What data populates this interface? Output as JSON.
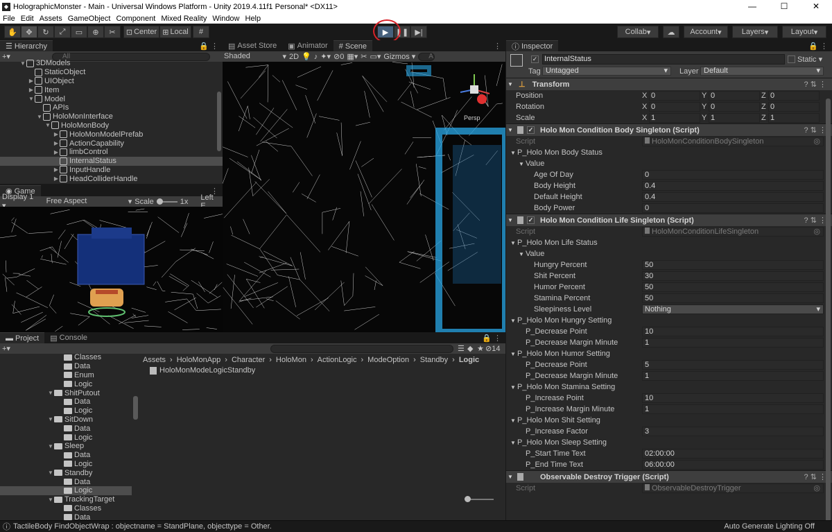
{
  "window": {
    "title": "HolographicMonster - Main - Universal Windows Platform - Unity 2019.4.11f1 Personal* <DX11>",
    "controls": {
      "minimize": "—",
      "maximize": "☐",
      "close": "✕"
    }
  },
  "menu": [
    "File",
    "Edit",
    "Assets",
    "GameObject",
    "Component",
    "Mixed Reality",
    "Window",
    "Help"
  ],
  "toolbar": {
    "pivot": "Center",
    "space": "Local",
    "collab": "Collab",
    "account": "Account",
    "layers": "Layers",
    "layout": "Layout"
  },
  "hierarchy": {
    "tab": "Hierarchy",
    "search_placeholder": "All",
    "items": [
      {
        "label": "3DModels",
        "indent": 3,
        "arrow": "▼"
      },
      {
        "label": "StaticObject",
        "indent": 4,
        "arrow": ""
      },
      {
        "label": "UIObject",
        "indent": 4,
        "arrow": "▶"
      },
      {
        "label": "Item",
        "indent": 4,
        "arrow": "▶"
      },
      {
        "label": "Model",
        "indent": 4,
        "arrow": "▼"
      },
      {
        "label": "APIs",
        "indent": 5,
        "arrow": ""
      },
      {
        "label": "HoloMonInterface",
        "indent": 5,
        "arrow": "▼"
      },
      {
        "label": "HoloMonBody",
        "indent": 6,
        "arrow": "▼"
      },
      {
        "label": "HoloMonModelPrefab",
        "indent": 7,
        "arrow": "▶"
      },
      {
        "label": "ActionCapability",
        "indent": 7,
        "arrow": "▶"
      },
      {
        "label": "limbControl",
        "indent": 7,
        "arrow": "▶"
      },
      {
        "label": "InternalStatus",
        "indent": 7,
        "arrow": "",
        "selected": true
      },
      {
        "label": "InputHandle",
        "indent": 7,
        "arrow": "▶"
      },
      {
        "label": "HeadColliderHandle",
        "indent": 7,
        "arrow": "▶"
      }
    ]
  },
  "game": {
    "tab": "Game",
    "display": "Display 1",
    "aspect": "Free Aspect",
    "scale_label": "Scale",
    "scale_value": "1x",
    "left_eye": "Left E"
  },
  "scene": {
    "tabs": [
      "Asset Store",
      "Animator",
      "Scene"
    ],
    "shading": "Shaded",
    "mode2d": "2D",
    "hidden_count": "0",
    "gizmos": "Gizmos",
    "search_placeholder": "A",
    "gizmo_axis": "Persp"
  },
  "project": {
    "tabs": [
      "Project",
      "Console"
    ],
    "badge_count": "14",
    "breadcrumb": [
      "Assets",
      "HoloMonApp",
      "Character",
      "HoloMon",
      "ActionLogic",
      "ModeOption",
      "Standby",
      "Logic"
    ],
    "files": [
      "HoloMonModeLogicStandby"
    ],
    "tree": [
      {
        "label": "Classes",
        "indent": 0,
        "arrow": ""
      },
      {
        "label": "Data",
        "indent": 0,
        "arrow": ""
      },
      {
        "label": "Enum",
        "indent": 0,
        "arrow": ""
      },
      {
        "label": "Logic",
        "indent": 0,
        "arrow": ""
      },
      {
        "label": "ShitPutout",
        "indent": -1,
        "arrow": "▼"
      },
      {
        "label": "Data",
        "indent": 0,
        "arrow": ""
      },
      {
        "label": "Logic",
        "indent": 0,
        "arrow": ""
      },
      {
        "label": "SitDown",
        "indent": -1,
        "arrow": "▼"
      },
      {
        "label": "Data",
        "indent": 0,
        "arrow": ""
      },
      {
        "label": "Logic",
        "indent": 0,
        "arrow": ""
      },
      {
        "label": "Sleep",
        "indent": -1,
        "arrow": "▼"
      },
      {
        "label": "Data",
        "indent": 0,
        "arrow": ""
      },
      {
        "label": "Logic",
        "indent": 0,
        "arrow": ""
      },
      {
        "label": "Standby",
        "indent": -1,
        "arrow": "▼"
      },
      {
        "label": "Data",
        "indent": 0,
        "arrow": ""
      },
      {
        "label": "Logic",
        "indent": 0,
        "arrow": "",
        "selected": true
      },
      {
        "label": "TrackingTarget",
        "indent": -1,
        "arrow": "▼"
      },
      {
        "label": "Classes",
        "indent": 0,
        "arrow": ""
      },
      {
        "label": "Data",
        "indent": 0,
        "arrow": ""
      }
    ]
  },
  "inspector": {
    "tab": "Inspector",
    "object_name": "InternalStatus",
    "static_label": "Static",
    "tag_label": "Tag",
    "tag_value": "Untagged",
    "layer_label": "Layer",
    "layer_value": "Default",
    "transform": {
      "title": "Transform",
      "rows": [
        {
          "label": "Position",
          "x": "0",
          "y": "0",
          "z": "0"
        },
        {
          "label": "Rotation",
          "x": "0",
          "y": "0",
          "z": "0"
        },
        {
          "label": "Scale",
          "x": "1",
          "y": "1",
          "z": "1"
        }
      ]
    },
    "components": [
      {
        "title": "Holo Mon Condition Body Singleton (Script)",
        "script_label": "Script",
        "script_value": "HoloMonConditionBodySingleton",
        "rows": [
          {
            "label": "P_Holo Mon Body Status",
            "level": 0,
            "arrow": "▼",
            "value": null
          },
          {
            "label": "Value",
            "level": 1,
            "arrow": "▼",
            "value": null
          },
          {
            "label": "Age Of Day",
            "level": 2,
            "value": "0"
          },
          {
            "label": "Body Height",
            "level": 2,
            "value": "0.4"
          },
          {
            "label": "Default Height",
            "level": 2,
            "value": "0.4"
          },
          {
            "label": "Body Power",
            "level": 2,
            "value": "0"
          }
        ]
      },
      {
        "title": "Holo Mon Condition Life Singleton (Script)",
        "script_label": "Script",
        "script_value": "HoloMonConditionLifeSingleton",
        "rows": [
          {
            "label": "P_Holo Mon Life Status",
            "level": 0,
            "arrow": "▼",
            "value": null
          },
          {
            "label": "Value",
            "level": 1,
            "arrow": "▼",
            "value": null
          },
          {
            "label": "Hungry Percent",
            "level": 2,
            "value": "50"
          },
          {
            "label": "Shit Percent",
            "level": 2,
            "value": "30"
          },
          {
            "label": "Humor Percent",
            "level": 2,
            "value": "50"
          },
          {
            "label": "Stamina Percent",
            "level": 2,
            "value": "50"
          },
          {
            "label": "Sleepiness Level",
            "level": 2,
            "value": "Nothing",
            "dropdown": true
          },
          {
            "label": "P_Holo Mon Hungry Setting",
            "level": 0,
            "arrow": "▼",
            "value": null
          },
          {
            "label": "P_Decrease Point",
            "level": 1,
            "value": "10"
          },
          {
            "label": "P_Decrease Margin Minute",
            "level": 1,
            "value": "1"
          },
          {
            "label": "P_Holo Mon Humor Setting",
            "level": 0,
            "arrow": "▼",
            "value": null
          },
          {
            "label": "P_Decrease Point",
            "level": 1,
            "value": "5"
          },
          {
            "label": "P_Decrease Margin Minute",
            "level": 1,
            "value": "1"
          },
          {
            "label": "P_Holo Mon Stamina Setting",
            "level": 0,
            "arrow": "▼",
            "value": null
          },
          {
            "label": "P_Increase Point",
            "level": 1,
            "value": "10"
          },
          {
            "label": "P_Increase Margin Minute",
            "level": 1,
            "value": "1"
          },
          {
            "label": "P_Holo Mon Shit Setting",
            "level": 0,
            "arrow": "▼",
            "value": null
          },
          {
            "label": "P_Increase Factor",
            "level": 1,
            "value": "3"
          },
          {
            "label": "P_Holo Mon Sleep Setting",
            "level": 0,
            "arrow": "▼",
            "value": null
          },
          {
            "label": "P_Start Time Text",
            "level": 1,
            "value": "02:00:00"
          },
          {
            "label": "P_End Time Text",
            "level": 1,
            "value": "06:00:00"
          }
        ]
      },
      {
        "title": "Observable Destroy Trigger (Script)",
        "script_label": "Script",
        "script_value": "ObservableDestroyTrigger",
        "rows": []
      }
    ]
  },
  "status": {
    "message": "TactileBody FindObjectWrap : objectname = StandPlane, objecttype = Other.",
    "right": "Auto Generate Lighting Off"
  },
  "colors": {
    "play_active": "#46607c",
    "highlight_ring": "#d8232a",
    "selection": "#4d4d4d"
  }
}
